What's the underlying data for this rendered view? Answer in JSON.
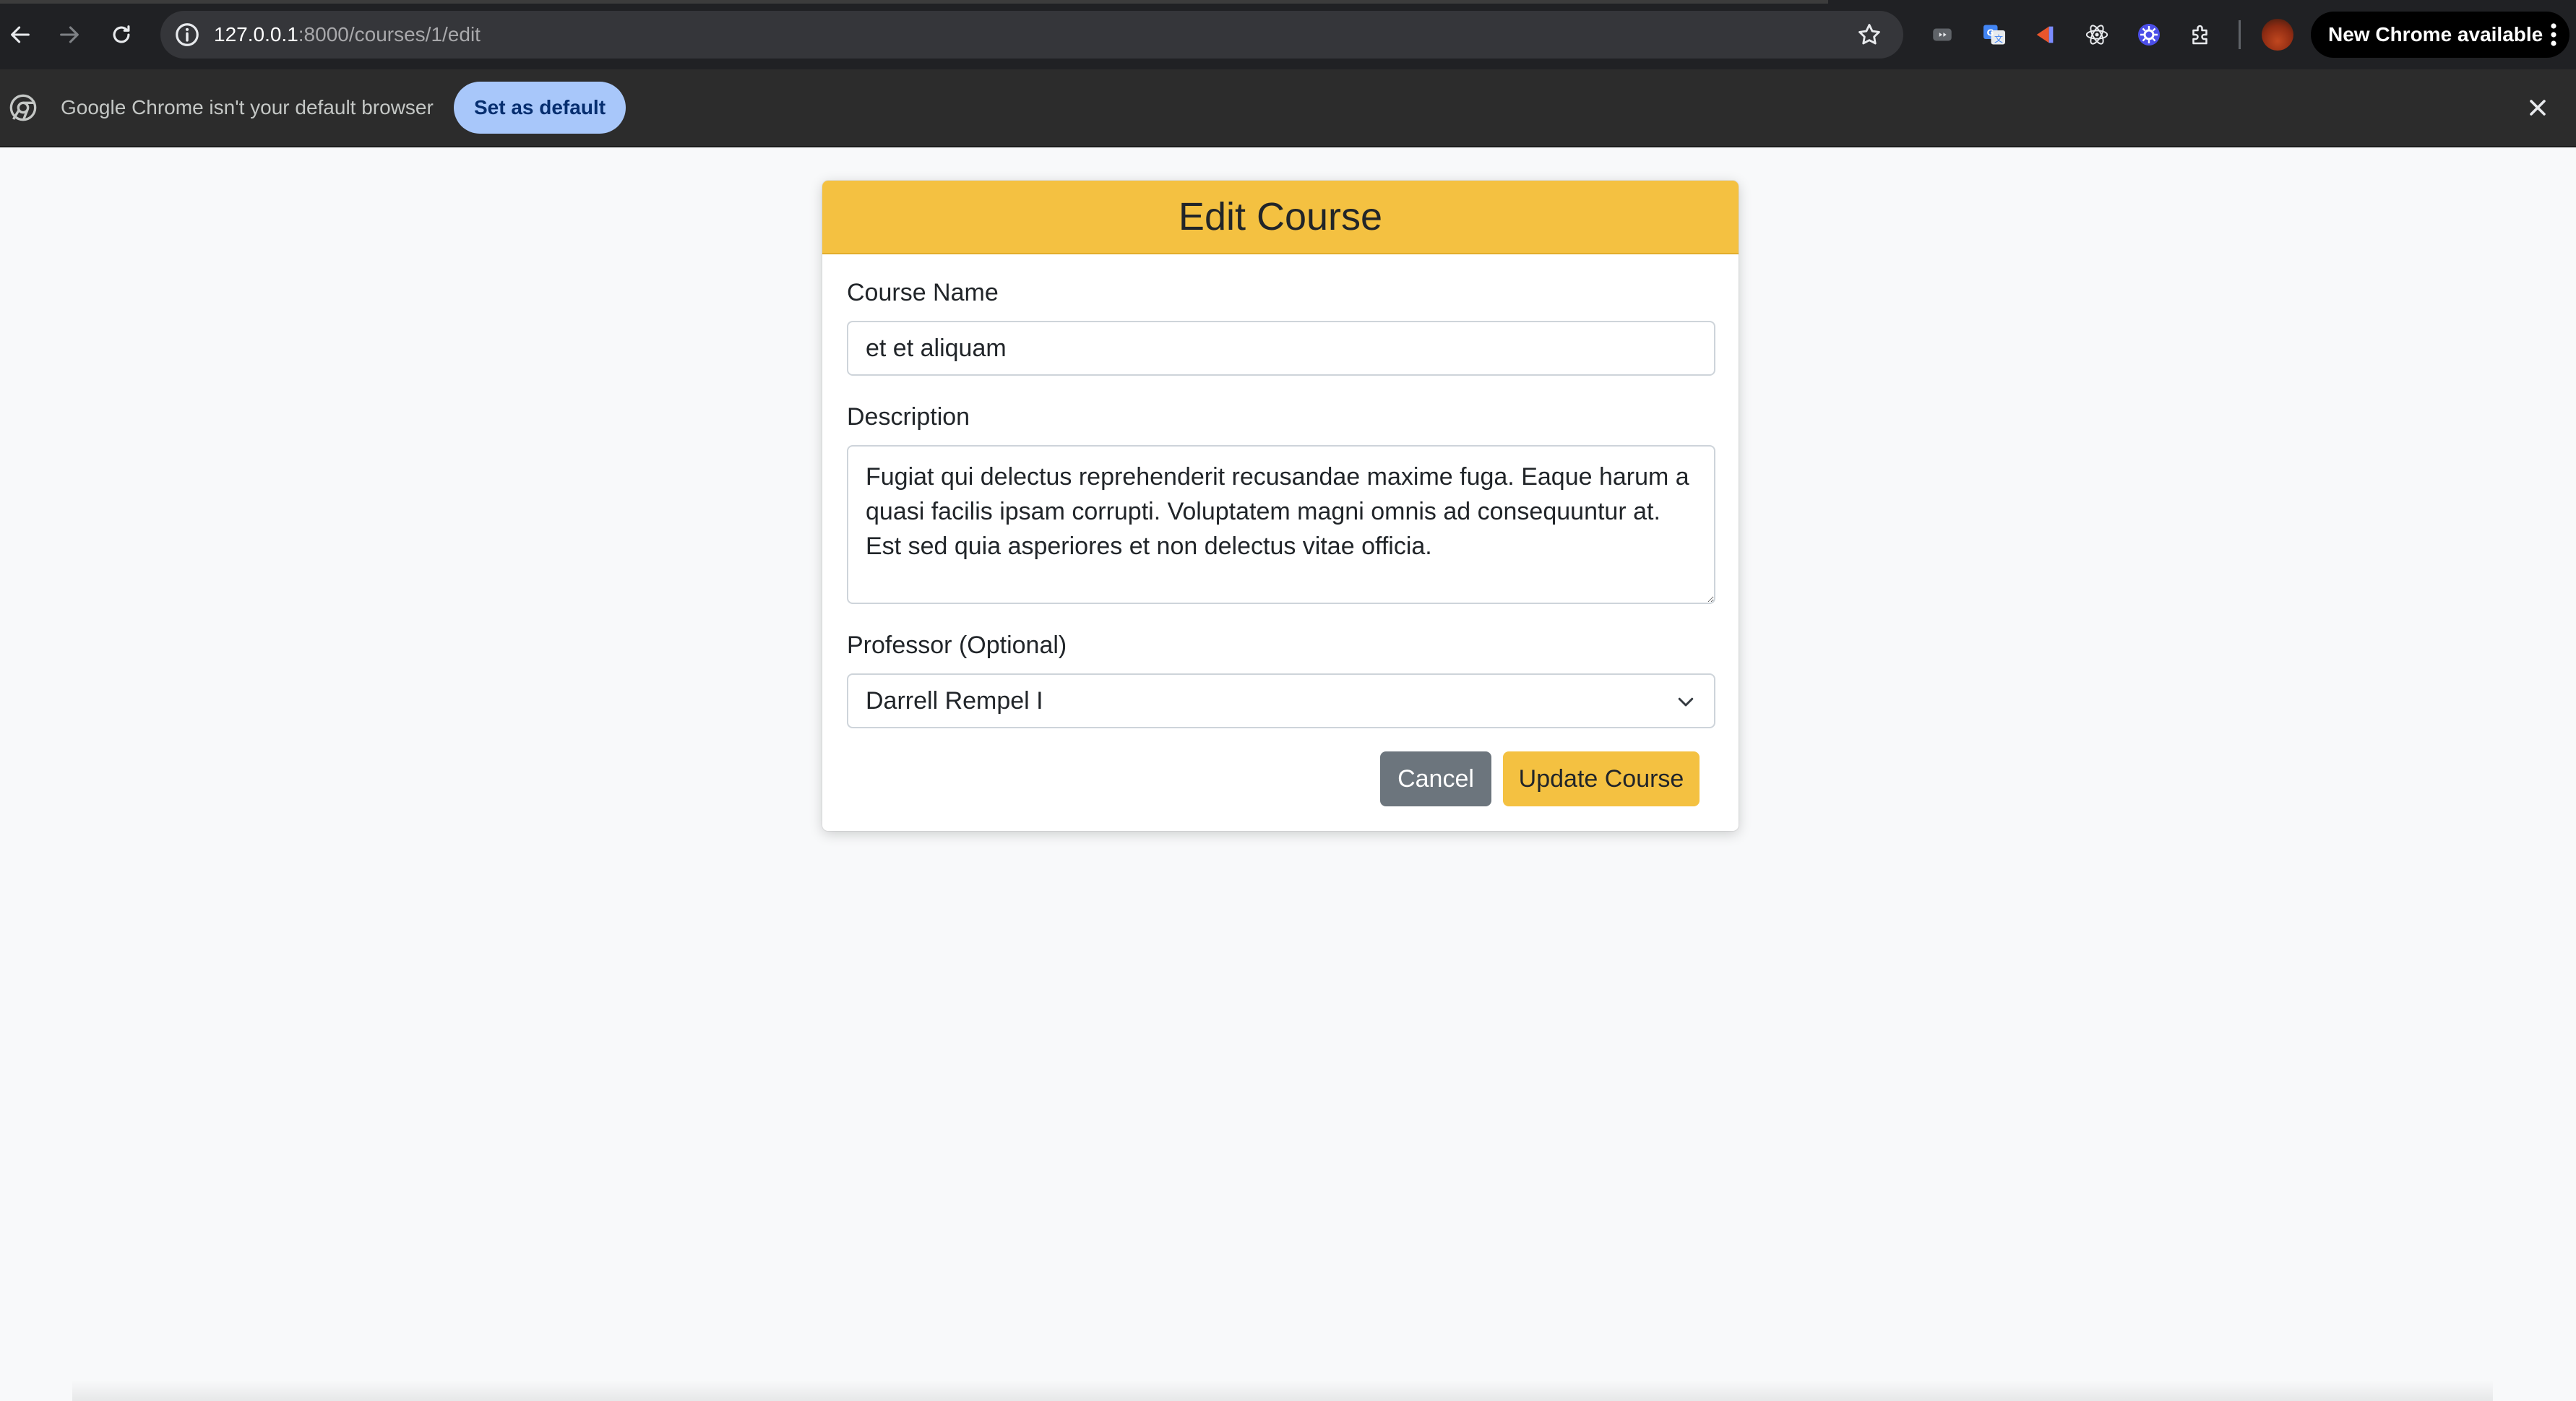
{
  "browser": {
    "url_host": "127.0.0.1",
    "url_path": ":8000/courses/1/edit",
    "new_chrome_label": "New Chrome available",
    "extensions": [
      "media-router-icon",
      "translate-icon",
      "sidebar-extension-icon",
      "react-devtools-icon",
      "settings-extension-icon",
      "puzzle-extensions-icon"
    ]
  },
  "infobar": {
    "message": "Google Chrome isn't your default browser",
    "set_default_label": "Set as default"
  },
  "form": {
    "title": "Edit Course",
    "course_name_label": "Course Name",
    "course_name_value": "et et aliquam",
    "description_label": "Description",
    "description_value": "Fugiat qui delectus reprehenderit recusandae maxime fuga. Eaque harum a quasi facilis ipsam corrupti. Voluptatem magni omnis ad consequuntur at. Est sed quia asperiores et non delectus vitae officia.",
    "professor_label": "Professor (Optional)",
    "professor_selected": "Darrell Rempel I",
    "cancel_label": "Cancel",
    "submit_label": "Update Course"
  },
  "colors": {
    "accent": "#f4c141",
    "secondary_button": "#6c757d",
    "page_background": "#f8f9fa"
  }
}
